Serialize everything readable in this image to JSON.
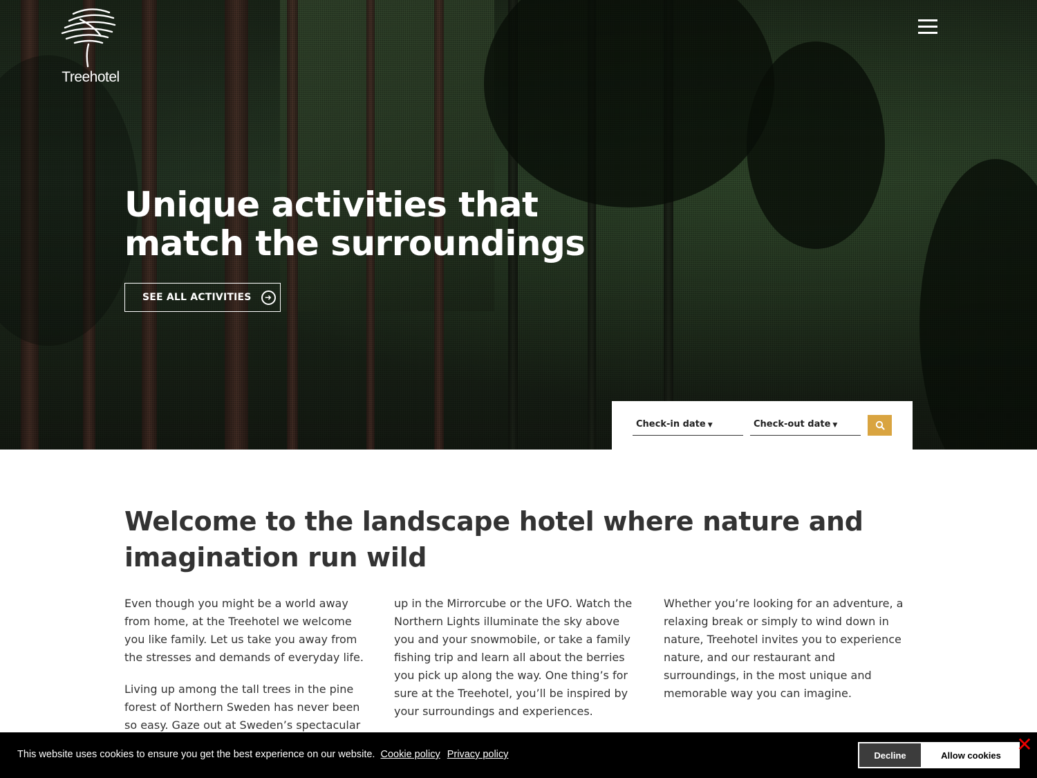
{
  "header": {
    "logo_text": "Treehotel",
    "logo_icon": "tree-logo-icon",
    "menu_icon": "hamburger-menu-icon"
  },
  "hero": {
    "title": "Unique activities that match the surroundings",
    "cta_label": "SEE ALL ACTIVITIES",
    "cta_icon": "arrow-circle-right-icon"
  },
  "booking": {
    "checkin_label": "Check-in date",
    "checkout_label": "Check-out date",
    "search_icon": "search-icon",
    "accent_color": "#d9a440"
  },
  "content": {
    "heading": "Welcome to the landscape hotel where nature and imagination run wild",
    "columns": [
      {
        "paragraphs": [
          "Even though you might be a world away from home, at the Treehotel we welcome you like family. Let us take you away from the stresses and demands of everyday life.",
          "Living up among the tall trees in the pine forest of Northern Sweden has never been so easy. Gaze out at Sweden’s spectacular nature from"
        ]
      },
      {
        "paragraphs": [
          "up in the Mirrorcube or the UFO. Watch the Northern Lights illuminate the sky above you and your snowmobile, or take a family fishing trip and learn all about the berries you pick up along the way. One thing’s for sure at the Treehotel, you’ll be inspired by your surroundings and experiences."
        ]
      },
      {
        "paragraphs": [
          "Whether you’re looking for an adventure, a relaxing break or simply to wind down in nature, Treehotel invites you to experience nature, and our restaurant and surroundings, in the most unique and memorable way you can imagine."
        ]
      }
    ]
  },
  "cookie_bar": {
    "message": "This website uses cookies to ensure you get the best experience on our website.",
    "cookie_policy_link": "Cookie policy",
    "privacy_policy_link": "Privacy policy",
    "decline_label": "Decline",
    "allow_label": "Allow cookies",
    "close_label": "✕",
    "close_color": "#e00000"
  }
}
